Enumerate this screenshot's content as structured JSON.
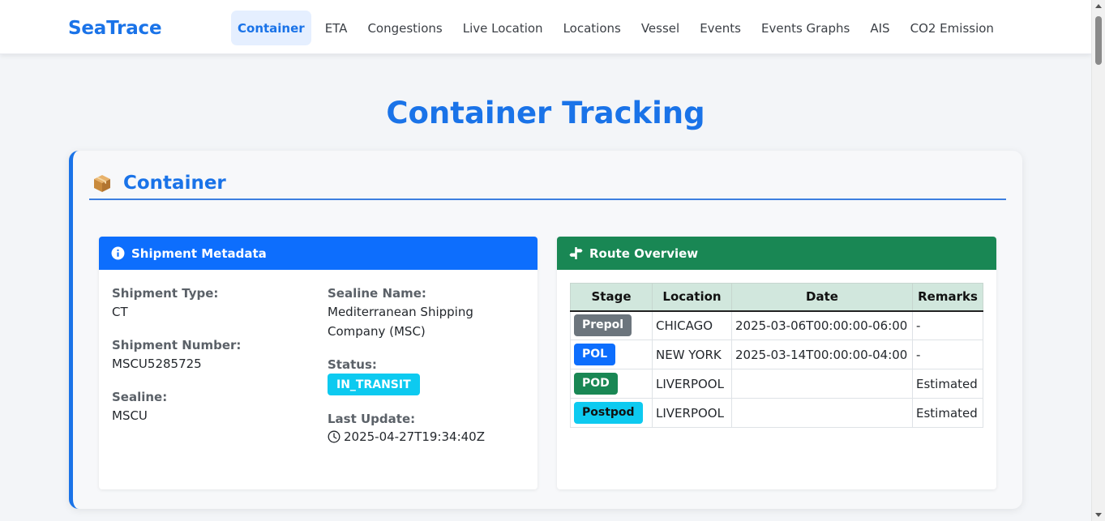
{
  "brand": "SeaTrace",
  "nav": {
    "items": [
      {
        "label": "Container",
        "active": true
      },
      {
        "label": "ETA",
        "active": false
      },
      {
        "label": "Congestions",
        "active": false
      },
      {
        "label": "Live Location",
        "active": false
      },
      {
        "label": "Locations",
        "active": false
      },
      {
        "label": "Vessel",
        "active": false
      },
      {
        "label": "Events",
        "active": false
      },
      {
        "label": "Events Graphs",
        "active": false
      },
      {
        "label": "AIS",
        "active": false
      },
      {
        "label": "CO2 Emission",
        "active": false
      }
    ]
  },
  "page_title": "Container Tracking",
  "section": {
    "icon": "package-box-icon",
    "title": "Container"
  },
  "metadata": {
    "header": "Shipment Metadata",
    "header_icon": "info-circle-icon",
    "shipment_type_label": "Shipment Type:",
    "shipment_type": "CT",
    "shipment_number_label": "Shipment Number:",
    "shipment_number": "MSCU5285725",
    "sealine_label": "Sealine:",
    "sealine": "MSCU",
    "sealine_name_label": "Sealine Name:",
    "sealine_name": "Mediterranean Shipping Company (MSC)",
    "status_label": "Status:",
    "status": "IN_TRANSIT",
    "last_update_label": "Last Update:",
    "last_update": "2025-04-27T19:34:40Z"
  },
  "route": {
    "header": "Route Overview",
    "header_icon": "signpost-icon",
    "columns": [
      "Stage",
      "Location",
      "Date",
      "Remarks"
    ],
    "rows": [
      {
        "stage": "Prepol",
        "location": "CHICAGO",
        "date": "2025-03-06T00:00:00-06:00",
        "remarks": "-",
        "badge_color": "#6c757d"
      },
      {
        "stage": "POL",
        "location": "NEW YORK",
        "date": "2025-03-14T00:00:00-04:00",
        "remarks": "-",
        "badge_color": "#0d6efd"
      },
      {
        "stage": "POD",
        "location": "LIVERPOOL",
        "date": "",
        "remarks": "Estimated",
        "badge_color": "#198754"
      },
      {
        "stage": "Postpod",
        "location": "LIVERPOOL",
        "date": "",
        "remarks": "Estimated",
        "badge_color": "#0dcaf0"
      }
    ]
  },
  "colors": {
    "accent": "#1a73e8",
    "primary": "#0d6efd",
    "success": "#198754",
    "info": "#0dcaf0",
    "secondary": "#6c757d"
  }
}
